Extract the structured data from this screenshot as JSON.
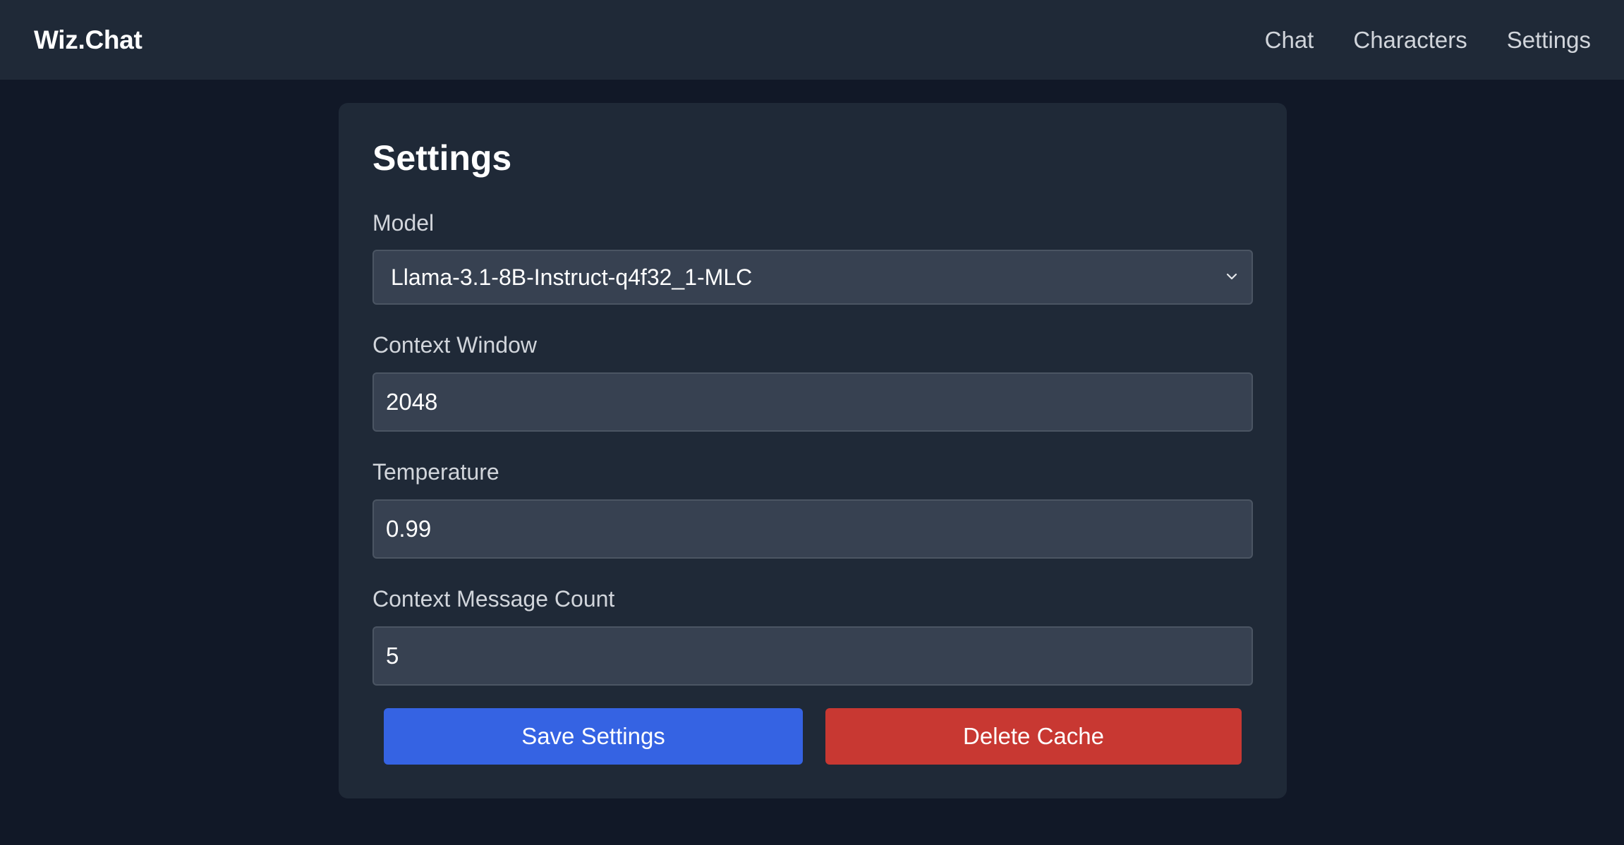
{
  "navbar": {
    "brand": "Wiz.Chat",
    "links": [
      {
        "label": "Chat"
      },
      {
        "label": "Characters"
      },
      {
        "label": "Settings"
      }
    ]
  },
  "settings": {
    "title": "Settings",
    "model": {
      "label": "Model",
      "value": "Llama-3.1-8B-Instruct-q4f32_1-MLC"
    },
    "context_window": {
      "label": "Context Window",
      "value": "2048"
    },
    "temperature": {
      "label": "Temperature",
      "value": "0.99"
    },
    "context_message_count": {
      "label": "Context Message Count",
      "value": "5"
    },
    "save_label": "Save Settings",
    "delete_label": "Delete Cache"
  },
  "colors": {
    "background": "#111827",
    "surface": "#1f2937",
    "input": "#374151",
    "primary": "#3563e3",
    "danger": "#c83832"
  },
  "icons": {
    "select_chevron": "chevron-down-icon"
  }
}
